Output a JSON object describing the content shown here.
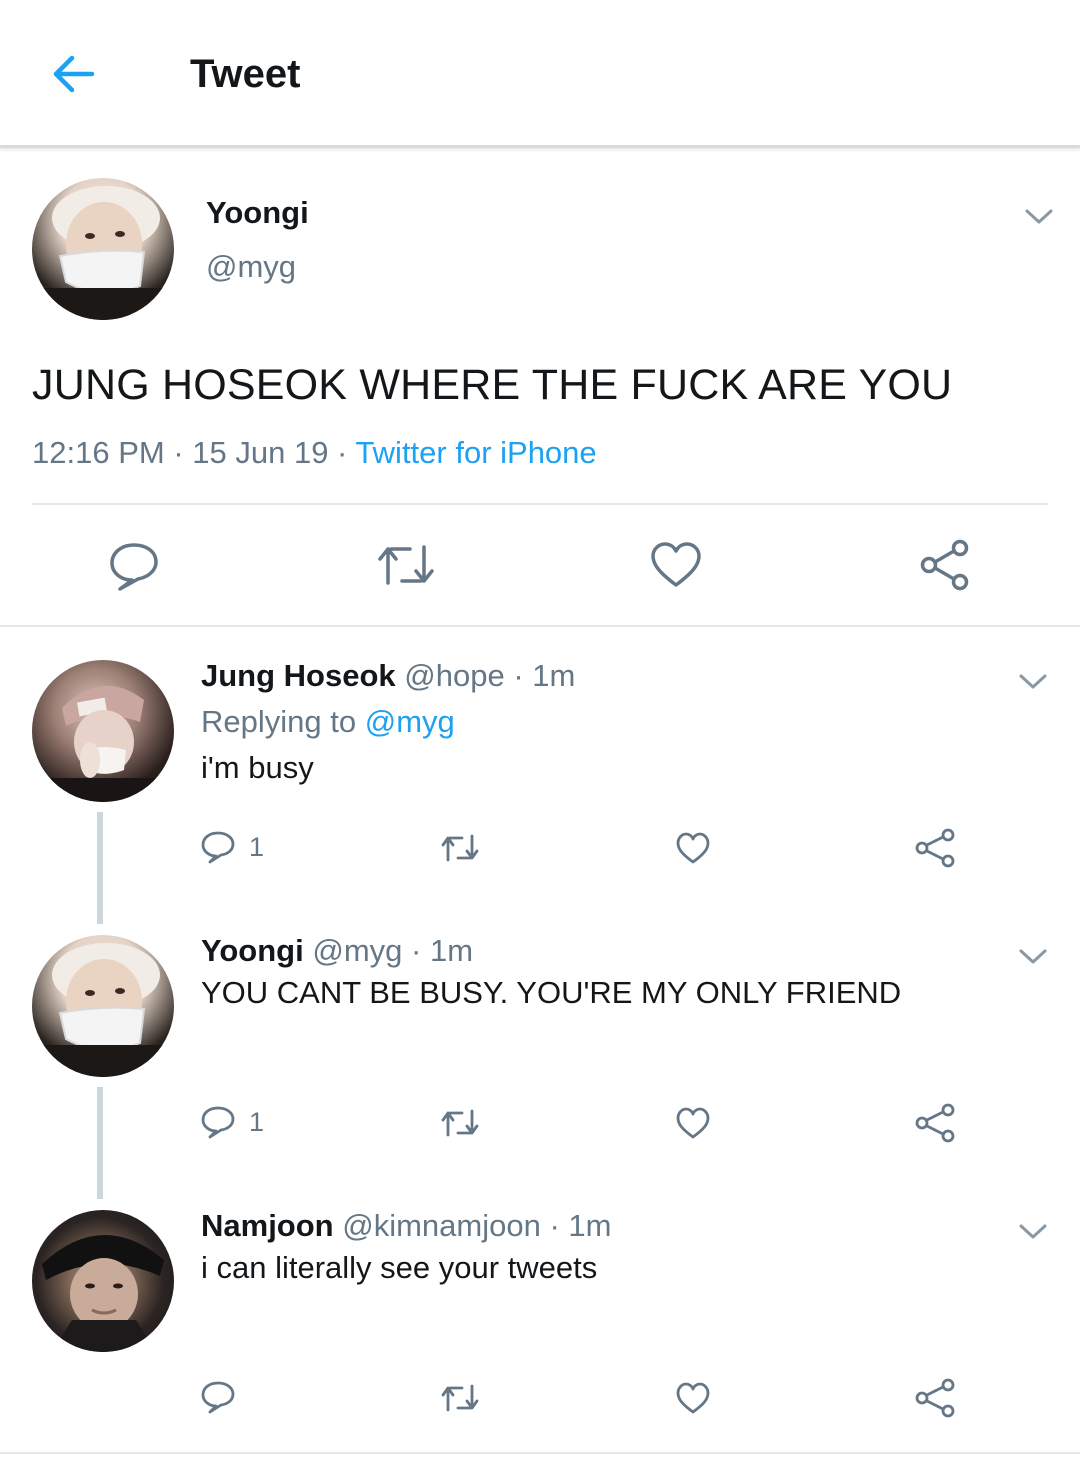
{
  "header": {
    "title": "Tweet",
    "back_icon": "arrow-left-icon",
    "accent_color": "#1da1f2"
  },
  "main_tweet": {
    "author_name": "Yoongi",
    "author_handle": "@myg",
    "text": "JUNG HOSEOK WHERE THE FUCK ARE YOU",
    "time": "12:16 PM",
    "date": "15 Jun 19",
    "source": "Twitter for iPhone",
    "separator": " · ",
    "actions": [
      "reply-icon",
      "retweet-icon",
      "like-icon",
      "share-icon"
    ]
  },
  "replies": [
    {
      "name": "Jung Hoseok",
      "handle": "@hope",
      "time": "1m",
      "replying_prefix": "Replying to ",
      "replying_to": "@myg",
      "text": "i'm busy",
      "reply_count": "1"
    },
    {
      "name": "Yoongi",
      "handle": "@myg",
      "time": "1m",
      "text": "YOU CANT BE BUSY. YOU'RE MY ONLY FRIEND",
      "reply_count": "1"
    },
    {
      "name": "Namjoon",
      "handle": "@kimnamjoon",
      "time": "1m",
      "text": "i can literally see your tweets",
      "reply_count": ""
    }
  ],
  "colors": {
    "text_primary": "#14171a",
    "text_secondary": "#657786",
    "link": "#1da1f2",
    "divider": "#e1e8ed",
    "thread_line": "#ccd6dd"
  }
}
